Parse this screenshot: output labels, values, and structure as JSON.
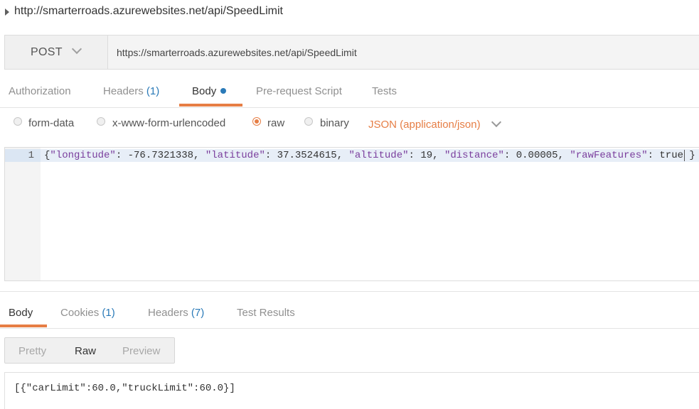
{
  "request": {
    "title": "http://smarterroads.azurewebsites.net/api/SpeedLimit",
    "method": "POST",
    "url": "https://smarterroads.azurewebsites.net/api/SpeedLimit"
  },
  "request_tabs": [
    {
      "label": "Authorization"
    },
    {
      "label": "Headers",
      "count": "(1)"
    },
    {
      "label": "Body"
    },
    {
      "label": "Pre-request Script"
    },
    {
      "label": "Tests"
    }
  ],
  "body_options": {
    "items": [
      {
        "label": "form-data",
        "selected": false
      },
      {
        "label": "x-www-form-urlencoded",
        "selected": false
      },
      {
        "label": "raw",
        "selected": true
      },
      {
        "label": "binary",
        "selected": false
      }
    ],
    "content_type": "JSON (application/json)"
  },
  "editor": {
    "line_number": "1",
    "code": {
      "open": "{",
      "k1": "\"longitude\"",
      "v1": ": -76.7321338, ",
      "k2": "\"latitude\"",
      "v2": ": 37.3524615, ",
      "k3": "\"altitude\"",
      "v3": ": 19, ",
      "k4": "\"distance\"",
      "v4": ": 0.00005, ",
      "k5": "\"rawFeatures\"",
      "v5": ": true }"
    }
  },
  "response_tabs": [
    {
      "label": "Body"
    },
    {
      "label": "Cookies",
      "count": "(1)"
    },
    {
      "label": "Headers",
      "count": "(7)"
    },
    {
      "label": "Test Results"
    }
  ],
  "view_modes": [
    "Pretty",
    "Raw",
    "Preview"
  ],
  "response_body": "[{\"carLimit\":60.0,\"truckLimit\":60.0}]",
  "colors": {
    "accent": "#e67e45",
    "link_blue": "#2a7ab8",
    "json_key": "#7a3e9d"
  },
  "icons": [
    "collapse-arrow-icon",
    "chevron-down-icon",
    "unsaved-dot-icon"
  ]
}
